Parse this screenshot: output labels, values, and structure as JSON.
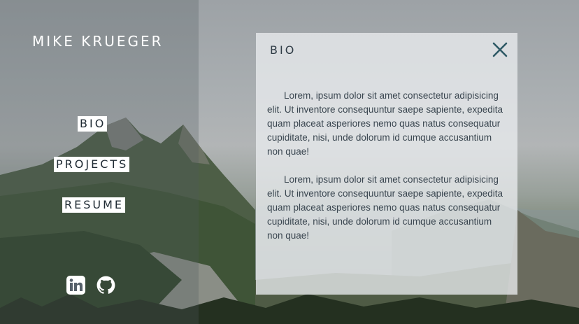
{
  "site": {
    "title": "MIKE KRUEGER"
  },
  "nav": {
    "items": [
      {
        "label": "BIO"
      },
      {
        "label": "PROJECTS"
      },
      {
        "label": "RESUME"
      }
    ]
  },
  "social": {
    "links": [
      {
        "icon": "linkedin-icon"
      },
      {
        "icon": "github-icon"
      }
    ]
  },
  "panel": {
    "title": "BIO",
    "close_icon": "close-icon",
    "paragraphs": [
      "Lorem, ipsum dolor sit amet consectetur adipisicing elit. Ut inventore consequuntur saepe sapiente, expedita quam placeat asperiores nemo quas natus consequatur cupiditate, nisi, unde dolorum id cumque accusantium non quae!",
      "Lorem, ipsum dolor sit amet consectetur adipisicing elit. Ut inventore consequuntur saepe sapiente, expedita quam placeat asperiores nemo quas natus consequatur cupiditate, nisi, unde dolorum id cumque accusantium non quae!"
    ]
  },
  "colors": {
    "accent_text": "#1f2a33",
    "panel_title": "#2f3c46",
    "close_icon": "#2e5a66"
  }
}
